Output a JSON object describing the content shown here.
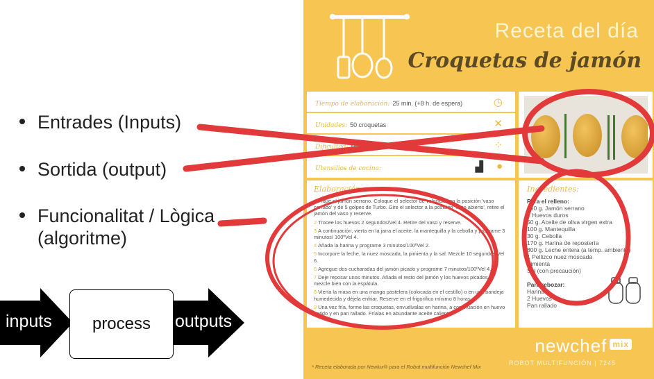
{
  "bullets": [
    {
      "text": "Entrades (Inputs)"
    },
    {
      "text": "Sortida (output)"
    },
    {
      "text": "Funcionalitat / Lògica",
      "text2": "(algoritme)"
    }
  ],
  "flow": {
    "inputs": "inputs",
    "process": "process",
    "outputs": "outputs"
  },
  "recipe": {
    "title1": "Receta del día",
    "title2": "Croquetas de jamón",
    "info": [
      {
        "label": "Tiempo de elaboración:",
        "value": "25 min. (+8 h. de espera)",
        "icon": "clock-icon"
      },
      {
        "label": "Unidades:",
        "value": "50 croquetas",
        "icon": "utensils-icon"
      },
      {
        "label": "Dificultad:",
        "value": "Media",
        "icon": "dots-icon"
      },
      {
        "label": "Utensilios de cocina:",
        "value": "",
        "icon": "robot-icon"
      }
    ],
    "elaboracion_title": "Elaboración:",
    "steps": [
      {
        "n": "1",
        "text": "Pique el jamón serrano. Coloque el selector de velocidad en la posición 'vaso cerrado' y dé 5 golpes de Turbo. Gire el selector a la posición 'vaso abierto', retire el jamón del vaso y reserve."
      },
      {
        "n": "2",
        "text": "Trocee los huevos 2 segundos/Vel 4. Retire del vaso y reserve."
      },
      {
        "n": "3",
        "text": "A continuación, vierta en la jarra el aceite, la mantequilla y la cebolla y programe 3 minutos/ 100ºVel 4."
      },
      {
        "n": "4",
        "text": "Añada la harina y programe 3 minutos/100ºVel 2."
      },
      {
        "n": "5",
        "text": "Incorpore la leche, la nuez moscada, la pimienta y la sal. Mezcle 10 segundos/Vel 6."
      },
      {
        "n": "6",
        "text": "Agregue dos cucharadas del jamón picado y programe 7 minutos/100ºVel 4."
      },
      {
        "n": "7",
        "text": "Deje reposar unos minutos. Añada el resto del jamón y los huevos picados y mezcle bien con la espátula."
      },
      {
        "n": "8",
        "text": "Vierta la masa en una manga pastelera (colocada en el cestillo) o en una bandeja humedecida y déjela enfriar. Reserve en el frigorífico mínimo 8 horas."
      },
      {
        "n": "9",
        "text": "Una vez fría, forme las croquetas, envuélvalas en harina, a continuación en huevo batido y en pan rallado. Fríalas en abundante aceite caliente."
      }
    ],
    "ingredientes_title": "Ingredientes:",
    "relleno_title": "Para el relleno:",
    "relleno": [
      "150 g. Jamón serrano",
      "2 Huevos duros",
      "50 g. Aceite de oliva virgen extra",
      "100 g. Mantequilla",
      "30 g. Cebolla",
      "170 g. Harina de repostería",
      "800 g. Leche entera (a temp. ambiente)",
      "1 Pellizco nuez moscada",
      "Pimienta",
      "Sal (con precaución)"
    ],
    "rebozar_title": "Para rebozar:",
    "rebozar": [
      "Harina",
      "2 Huevos",
      "Pan rallado"
    ],
    "brand": "newchef",
    "brand_badge": "mix",
    "brand_sub": "ROBOT MULTIFUNCIÓN | 7245",
    "footnote": "* Receta elaborada por Newlux® para el Robot multifunción Newchef Mix"
  },
  "colors": {
    "card": "#f6c552",
    "annotation": "#e23a3a"
  }
}
